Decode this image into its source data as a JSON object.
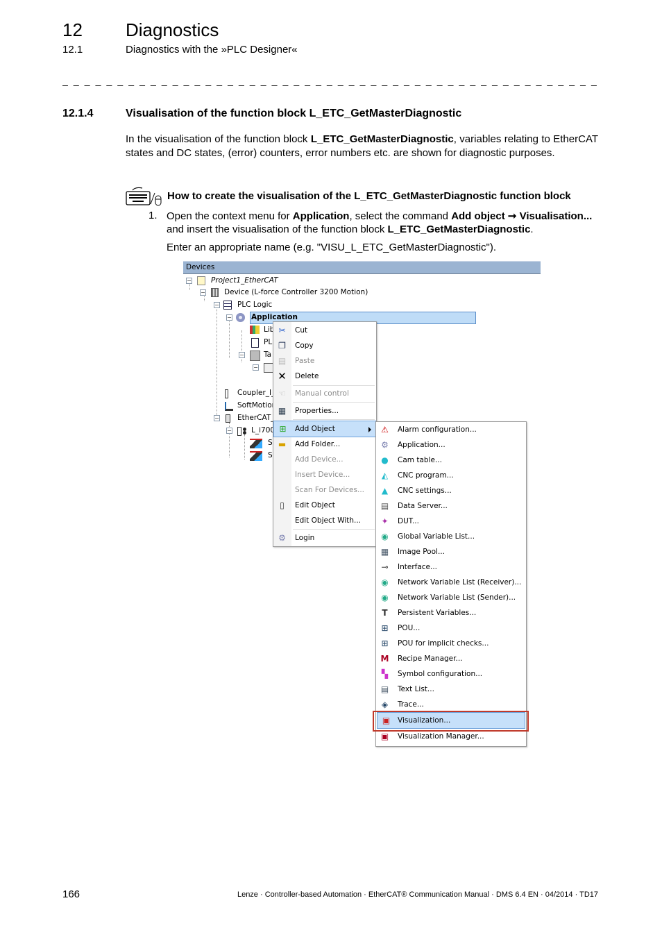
{
  "header": {
    "chapter_number": "12",
    "chapter_title": "Diagnostics",
    "section_number": "12.1",
    "section_title": "Diagnostics with the »PLC Designer«",
    "divider": "_ _ _ _ _ _ _ _ _ _ _ _ _ _ _ _ _ _ _ _ _ _ _ _ _ _ _ _ _ _ _ _ _ _ _ _ _ _ _ _ _ _ _ _ _ _ _ _ _ _ _ _ _ _ _ _ _ _ _ _ _ _ _ _"
  },
  "subsection": {
    "number": "12.1.4",
    "title": "Visualisation of the function block L_ETC_GetMasterDiagnostic"
  },
  "intro": {
    "p1": "In the visualisation of the function block ",
    "p1_bold": "L_ETC_GetMasterDiagnostic",
    "p1_rest": ", variables relating to EtherCAT states and DC states, (error) counters, error numbers etc. are shown for diagnostic purposes."
  },
  "howto": {
    "icon": "keyboard-mouse-icon",
    "title": "How to create the visualisation of the L_ETC_GetMasterDiagnostic function block"
  },
  "step1": {
    "number": "1.",
    "t1": "Open the context menu for ",
    "b1": "Application",
    "t2": ", select the command ",
    "b2": "Add object ➞ Visualisation...",
    "t3": " and insert the visualisation of the function block ",
    "b3": "L_ETC_GetMasterDiagnostic",
    "t4": ".",
    "t5": "Enter an appropriate name (e.g. \"VISU_L_ETC_GetMasterDiagnostic\")."
  },
  "screenshot": {
    "panel_title": "Devices",
    "tree": [
      {
        "label": "Project1_EtherCAT",
        "icon": "project-icon"
      },
      {
        "label": "Device (L-force Controller 3200 Motion)",
        "icon": "device-icon"
      },
      {
        "label": "PLC Logic",
        "icon": "plc-logic-icon"
      },
      {
        "label": "Application",
        "icon": "application-gear-icon"
      },
      {
        "label": "Lib",
        "icon": "library-icon"
      },
      {
        "label": "PL",
        "icon": "pou-icon"
      },
      {
        "label": "Ta",
        "icon": "task-icon"
      },
      {
        "label": "",
        "icon": "task-item-icon"
      },
      {
        "label": "Coupler_I_",
        "icon": "coupler-icon"
      },
      {
        "label": "SoftMotion",
        "icon": "softmotion-icon"
      },
      {
        "label": "EtherCAT_",
        "icon": "ethercat-icon"
      },
      {
        "label": "L_i700",
        "icon": "drive-icon"
      },
      {
        "label": "S",
        "icon": "axis-icon"
      },
      {
        "label": "S",
        "icon": "axis-icon"
      }
    ],
    "context_menu": [
      {
        "label": "Cut",
        "icon": "scissors-icon",
        "disabled": false
      },
      {
        "label": "Copy",
        "icon": "copy-icon",
        "disabled": false
      },
      {
        "label": "Paste",
        "icon": "paste-icon",
        "disabled": true
      },
      {
        "label": "Delete",
        "icon": "delete-x-icon",
        "disabled": false
      },
      {
        "label": "Manual control",
        "icon": "hand-icon",
        "disabled": true
      },
      {
        "label": "Properties...",
        "icon": "properties-icon",
        "disabled": false
      },
      {
        "label": "Add Object",
        "icon": "add-object-icon",
        "disabled": false,
        "submenu": true
      },
      {
        "label": "Add Folder...",
        "icon": "folder-icon",
        "disabled": false
      },
      {
        "label": "Add Device...",
        "icon": "",
        "disabled": true
      },
      {
        "label": "Insert Device...",
        "icon": "",
        "disabled": true
      },
      {
        "label": "Scan For Devices...",
        "icon": "",
        "disabled": true
      },
      {
        "label": "Edit Object",
        "icon": "edit-object-icon",
        "disabled": false
      },
      {
        "label": "Edit Object With...",
        "icon": "",
        "disabled": false
      },
      {
        "label": "Login",
        "icon": "login-icon",
        "disabled": false
      }
    ],
    "submenu": [
      {
        "label": "Alarm configuration...",
        "icon": "alarm-icon"
      },
      {
        "label": "Application...",
        "icon": "gear-icon"
      },
      {
        "label": "Cam table...",
        "icon": "cam-table-icon"
      },
      {
        "label": "CNC program...",
        "icon": "cnc-program-icon"
      },
      {
        "label": "CNC settings...",
        "icon": "cnc-settings-icon"
      },
      {
        "label": "Data Server...",
        "icon": "data-server-icon"
      },
      {
        "label": "DUT...",
        "icon": "dut-icon"
      },
      {
        "label": "Global Variable List...",
        "icon": "globe-icon"
      },
      {
        "label": "Image Pool...",
        "icon": "image-pool-icon"
      },
      {
        "label": "Interface...",
        "icon": "interface-icon"
      },
      {
        "label": "Network Variable List (Receiver)...",
        "icon": "globe-receiver-icon"
      },
      {
        "label": "Network Variable List (Sender)...",
        "icon": "globe-sender-icon"
      },
      {
        "label": "Persistent Variables...",
        "icon": "persistent-icon"
      },
      {
        "label": "POU...",
        "icon": "pou-icon"
      },
      {
        "label": "POU for implicit checks...",
        "icon": "pou-checks-icon"
      },
      {
        "label": "Recipe Manager...",
        "icon": "recipe-icon"
      },
      {
        "label": "Symbol configuration...",
        "icon": "symbol-config-icon"
      },
      {
        "label": "Text List...",
        "icon": "text-list-icon"
      },
      {
        "label": "Trace...",
        "icon": "trace-icon"
      },
      {
        "label": "Visualization...",
        "icon": "visualization-icon",
        "highlighted": true
      },
      {
        "label": "Visualization Manager...",
        "icon": "visualization-manager-icon"
      }
    ],
    "highlight_color": "#c6e0fa",
    "callout_color": "#c0392b"
  },
  "footer": {
    "page": "166",
    "text": "Lenze · Controller-based Automation · EtherCAT® Communication Manual · DMS 6.4 EN · 04/2014 · TD17"
  }
}
